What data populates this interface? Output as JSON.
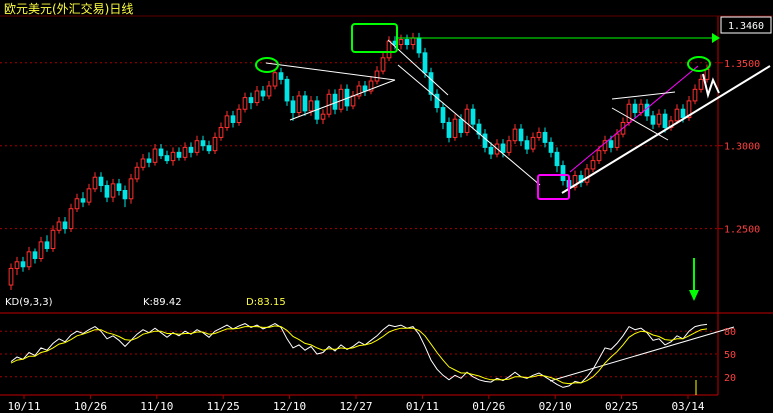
{
  "window": {
    "title": "欧元美元(外汇交易)日线",
    "current_price": "1.3460"
  },
  "indicator": {
    "name": "KD(9,3,3)",
    "k_label": "K:89.42",
    "d_label": "D:83.15"
  },
  "colors": {
    "up": "#ff3030",
    "down": "#00e5e5",
    "k_line": "#ffffff",
    "d_line": "#ffff00",
    "grid": "#a00000",
    "axis_text": "#ff4040",
    "trendline": "#ffffff",
    "channel": "#ff00ff",
    "highlight": "#00ff00"
  },
  "chart_data": [
    {
      "type": "candlestick",
      "title": "欧元美元(外汇交易)日线",
      "x_tick_labels": [
        "10/11",
        "10/26",
        "11/10",
        "11/25",
        "12/10",
        "12/27",
        "01/11",
        "01/26",
        "02/10",
        "02/25",
        "03/14"
      ],
      "y_tick_labels": [
        "1.3500",
        "1.3000",
        "1.2500"
      ],
      "y_ticks": [
        1.35,
        1.3,
        1.25
      ],
      "ylim": [
        1.213,
        1.377
      ],
      "last_price": 1.346,
      "grid": true,
      "candles": [
        [
          1.216,
          1.226,
          1.213,
          1.229
        ],
        [
          1.226,
          1.23,
          1.222,
          1.233
        ],
        [
          1.23,
          1.227,
          1.224,
          1.233
        ],
        [
          1.227,
          1.236,
          1.225,
          1.239
        ],
        [
          1.236,
          1.232,
          1.229,
          1.238
        ],
        [
          1.232,
          1.242,
          1.23,
          1.245
        ],
        [
          1.242,
          1.238,
          1.236,
          1.246
        ],
        [
          1.238,
          1.249,
          1.236,
          1.252
        ],
        [
          1.249,
          1.254,
          1.247,
          1.257
        ],
        [
          1.254,
          1.25,
          1.247,
          1.257
        ],
        [
          1.25,
          1.262,
          1.248,
          1.265
        ],
        [
          1.262,
          1.268,
          1.26,
          1.271
        ],
        [
          1.268,
          1.266,
          1.263,
          1.272
        ],
        [
          1.266,
          1.274,
          1.264,
          1.277
        ],
        [
          1.274,
          1.281,
          1.272,
          1.284
        ],
        [
          1.281,
          1.276,
          1.272,
          1.284
        ],
        [
          1.276,
          1.269,
          1.266,
          1.279
        ],
        [
          1.269,
          1.277,
          1.266,
          1.28
        ],
        [
          1.277,
          1.273,
          1.27,
          1.28
        ],
        [
          1.273,
          1.268,
          1.263,
          1.276
        ],
        [
          1.268,
          1.28,
          1.265,
          1.283
        ],
        [
          1.28,
          1.287,
          1.278,
          1.29
        ],
        [
          1.287,
          1.292,
          1.285,
          1.295
        ],
        [
          1.292,
          1.29,
          1.287,
          1.296
        ],
        [
          1.29,
          1.298,
          1.288,
          1.301
        ],
        [
          1.298,
          1.294,
          1.292,
          1.301
        ],
        [
          1.294,
          1.291,
          1.289,
          1.297
        ],
        [
          1.291,
          1.296,
          1.288,
          1.299
        ],
        [
          1.296,
          1.293,
          1.291,
          1.299
        ],
        [
          1.293,
          1.299,
          1.291,
          1.302
        ],
        [
          1.299,
          1.296,
          1.293,
          1.302
        ],
        [
          1.296,
          1.303,
          1.294,
          1.306
        ],
        [
          1.303,
          1.3,
          1.297,
          1.306
        ],
        [
          1.3,
          1.297,
          1.295,
          1.303
        ],
        [
          1.297,
          1.305,
          1.295,
          1.308
        ],
        [
          1.305,
          1.311,
          1.303,
          1.314
        ],
        [
          1.311,
          1.318,
          1.309,
          1.321
        ],
        [
          1.318,
          1.314,
          1.311,
          1.321
        ],
        [
          1.314,
          1.322,
          1.312,
          1.325
        ],
        [
          1.322,
          1.329,
          1.32,
          1.332
        ],
        [
          1.329,
          1.326,
          1.322,
          1.332
        ],
        [
          1.326,
          1.333,
          1.324,
          1.336
        ],
        [
          1.333,
          1.33,
          1.327,
          1.336
        ],
        [
          1.33,
          1.336,
          1.328,
          1.339
        ],
        [
          1.336,
          1.344,
          1.334,
          1.346
        ],
        [
          1.344,
          1.34,
          1.337,
          1.347
        ],
        [
          1.34,
          1.327,
          1.324,
          1.342
        ],
        [
          1.327,
          1.32,
          1.315,
          1.33
        ],
        [
          1.32,
          1.33,
          1.318,
          1.333
        ],
        [
          1.33,
          1.321,
          1.318,
          1.333
        ],
        [
          1.321,
          1.327,
          1.318,
          1.33
        ],
        [
          1.327,
          1.316,
          1.313,
          1.33
        ],
        [
          1.316,
          1.319,
          1.313,
          1.322
        ],
        [
          1.319,
          1.331,
          1.317,
          1.334
        ],
        [
          1.331,
          1.322,
          1.319,
          1.334
        ],
        [
          1.322,
          1.334,
          1.32,
          1.337
        ],
        [
          1.334,
          1.324,
          1.321,
          1.337
        ],
        [
          1.324,
          1.33,
          1.322,
          1.333
        ],
        [
          1.33,
          1.336,
          1.328,
          1.339
        ],
        [
          1.336,
          1.333,
          1.33,
          1.339
        ],
        [
          1.333,
          1.339,
          1.331,
          1.342
        ],
        [
          1.339,
          1.345,
          1.337,
          1.348
        ],
        [
          1.345,
          1.353,
          1.343,
          1.356
        ],
        [
          1.353,
          1.363,
          1.351,
          1.366
        ],
        [
          1.363,
          1.361,
          1.358,
          1.366
        ],
        [
          1.361,
          1.364,
          1.358,
          1.367
        ],
        [
          1.364,
          1.361,
          1.358,
          1.367
        ],
        [
          1.361,
          1.365,
          1.358,
          1.368
        ],
        [
          1.365,
          1.356,
          1.353,
          1.368
        ],
        [
          1.356,
          1.344,
          1.341,
          1.359
        ],
        [
          1.344,
          1.331,
          1.327,
          1.347
        ],
        [
          1.331,
          1.323,
          1.32,
          1.334
        ],
        [
          1.323,
          1.314,
          1.31,
          1.326
        ],
        [
          1.314,
          1.305,
          1.302,
          1.317
        ],
        [
          1.305,
          1.316,
          1.303,
          1.319
        ],
        [
          1.316,
          1.308,
          1.305,
          1.319
        ],
        [
          1.308,
          1.322,
          1.306,
          1.325
        ],
        [
          1.322,
          1.313,
          1.31,
          1.325
        ],
        [
          1.313,
          1.307,
          1.304,
          1.316
        ],
        [
          1.307,
          1.299,
          1.296,
          1.31
        ],
        [
          1.299,
          1.295,
          1.292,
          1.302
        ],
        [
          1.295,
          1.301,
          1.293,
          1.304
        ],
        [
          1.301,
          1.296,
          1.293,
          1.304
        ],
        [
          1.296,
          1.303,
          1.294,
          1.306
        ],
        [
          1.303,
          1.31,
          1.301,
          1.313
        ],
        [
          1.31,
          1.303,
          1.3,
          1.313
        ],
        [
          1.303,
          1.298,
          1.295,
          1.306
        ],
        [
          1.298,
          1.305,
          1.296,
          1.308
        ],
        [
          1.305,
          1.308,
          1.303,
          1.311
        ],
        [
          1.308,
          1.302,
          1.299,
          1.311
        ],
        [
          1.302,
          1.296,
          1.293,
          1.305
        ],
        [
          1.296,
          1.288,
          1.284,
          1.299
        ],
        [
          1.288,
          1.279,
          1.276,
          1.291
        ],
        [
          1.279,
          1.275,
          1.272,
          1.282
        ],
        [
          1.275,
          1.282,
          1.273,
          1.285
        ],
        [
          1.282,
          1.278,
          1.275,
          1.285
        ],
        [
          1.278,
          1.286,
          1.276,
          1.289
        ],
        [
          1.286,
          1.291,
          1.284,
          1.294
        ],
        [
          1.291,
          1.297,
          1.289,
          1.3
        ],
        [
          1.297,
          1.303,
          1.295,
          1.306
        ],
        [
          1.303,
          1.299,
          1.296,
          1.306
        ],
        [
          1.299,
          1.307,
          1.297,
          1.31
        ],
        [
          1.307,
          1.314,
          1.305,
          1.317
        ],
        [
          1.314,
          1.325,
          1.312,
          1.328
        ],
        [
          1.325,
          1.32,
          1.317,
          1.328
        ],
        [
          1.32,
          1.325,
          1.318,
          1.328
        ],
        [
          1.325,
          1.318,
          1.315,
          1.328
        ],
        [
          1.318,
          1.313,
          1.31,
          1.321
        ],
        [
          1.313,
          1.319,
          1.311,
          1.322
        ],
        [
          1.319,
          1.311,
          1.308,
          1.322
        ],
        [
          1.311,
          1.315,
          1.309,
          1.318
        ],
        [
          1.315,
          1.322,
          1.313,
          1.325
        ],
        [
          1.322,
          1.317,
          1.314,
          1.325
        ],
        [
          1.317,
          1.327,
          1.315,
          1.33
        ],
        [
          1.327,
          1.334,
          1.325,
          1.337
        ],
        [
          1.334,
          1.34,
          1.332,
          1.343
        ],
        [
          1.34,
          1.346,
          1.338,
          1.349
        ]
      ]
    },
    {
      "type": "line",
      "title": "KD(9,3,3)",
      "ylim": [
        0,
        100
      ],
      "y_tick_labels": [
        "80",
        "50",
        "20"
      ],
      "y_ticks": [
        80,
        50,
        20
      ],
      "series": [
        {
          "name": "K",
          "values": [
            40,
            46,
            43,
            52,
            48,
            58,
            55,
            64,
            70,
            66,
            75,
            80,
            77,
            82,
            86,
            80,
            70,
            74,
            68,
            60,
            68,
            76,
            82,
            78,
            84,
            78,
            72,
            78,
            74,
            80,
            76,
            82,
            78,
            72,
            80,
            84,
            88,
            83,
            87,
            90,
            85,
            88,
            83,
            86,
            90,
            85,
            70,
            58,
            62,
            55,
            60,
            50,
            52,
            60,
            54,
            62,
            56,
            60,
            66,
            62,
            68,
            74,
            82,
            88,
            86,
            88,
            84,
            86,
            76,
            60,
            42,
            30,
            22,
            16,
            22,
            18,
            26,
            20,
            16,
            14,
            13,
            18,
            15,
            20,
            26,
            20,
            18,
            22,
            25,
            20,
            15,
            10,
            6,
            8,
            14,
            12,
            20,
            30,
            44,
            58,
            56,
            64,
            74,
            86,
            82,
            84,
            78,
            68,
            70,
            62,
            66,
            74,
            70,
            80,
            86,
            88,
            89
          ]
        },
        {
          "name": "D",
          "values": [
            38,
            42,
            43,
            47,
            47,
            52,
            54,
            58,
            63,
            65,
            69,
            74,
            76,
            79,
            82,
            82,
            78,
            76,
            73,
            69,
            68,
            71,
            76,
            78,
            80,
            80,
            77,
            77,
            76,
            77,
            77,
            79,
            79,
            76,
            77,
            80,
            83,
            83,
            84,
            86,
            86,
            86,
            85,
            85,
            87,
            86,
            81,
            73,
            69,
            64,
            62,
            58,
            55,
            57,
            56,
            58,
            57,
            58,
            61,
            62,
            64,
            68,
            73,
            79,
            82,
            84,
            84,
            84,
            81,
            74,
            63,
            52,
            42,
            33,
            29,
            25,
            25,
            23,
            21,
            18,
            16,
            16,
            16,
            17,
            20,
            20,
            19,
            20,
            22,
            21,
            19,
            16,
            12,
            11,
            12,
            12,
            15,
            20,
            28,
            38,
            46,
            53,
            62,
            72,
            77,
            80,
            79,
            75,
            73,
            69,
            68,
            70,
            70,
            74,
            78,
            82,
            83
          ]
        }
      ]
    }
  ]
}
